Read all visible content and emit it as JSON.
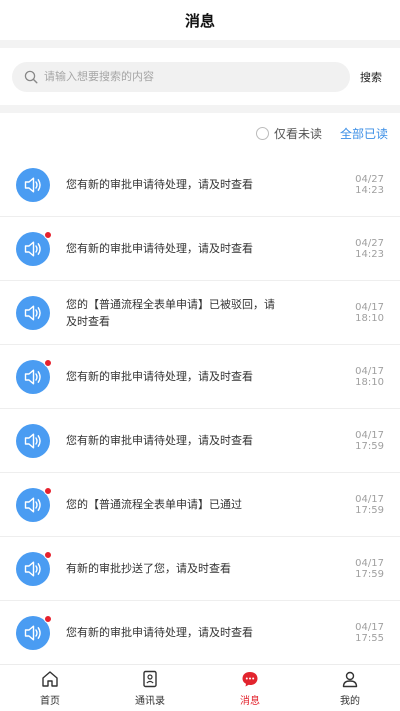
{
  "header": {
    "title": "消息"
  },
  "search": {
    "placeholder": "请输入想要搜索的内容",
    "button_label": "搜索"
  },
  "filter": {
    "unread_only_label": "仅看未读",
    "mark_all_read_label": "全部已读"
  },
  "messages": [
    {
      "text": "您有新的审批申请待处理，请及时查看",
      "time": "04/27 14:23",
      "unread": false
    },
    {
      "text": "您有新的审批申请待处理，请及时查看",
      "time": "04/27 14:23",
      "unread": true
    },
    {
      "text": "您的【普通流程全表单申请】已被驳回，请及时查看",
      "time": "04/17 18:10",
      "unread": false
    },
    {
      "text": "您有新的审批申请待处理，请及时查看",
      "time": "04/17 18:10",
      "unread": true
    },
    {
      "text": "您有新的审批申请待处理，请及时查看",
      "time": "04/17 17:59",
      "unread": false
    },
    {
      "text": "您的【普通流程全表单申请】已通过",
      "time": "04/17 17:59",
      "unread": true
    },
    {
      "text": "有新的审批抄送了您，请及时查看",
      "time": "04/17 17:59",
      "unread": true
    },
    {
      "text": "您有新的审批申请待处理，请及时查看",
      "time": "04/17 17:55",
      "unread": true
    }
  ],
  "tabbar": [
    {
      "label": "首页",
      "icon": "home-icon",
      "active": false
    },
    {
      "label": "通讯录",
      "icon": "contacts-icon",
      "active": false
    },
    {
      "label": "消息",
      "icon": "message-icon",
      "active": true
    },
    {
      "label": "我的",
      "icon": "profile-icon",
      "active": false
    }
  ],
  "colors": {
    "accent": "#e2242e",
    "link": "#3a8ee6",
    "avatar": "#4a9cf2",
    "unread_dot": "#e7212d"
  }
}
